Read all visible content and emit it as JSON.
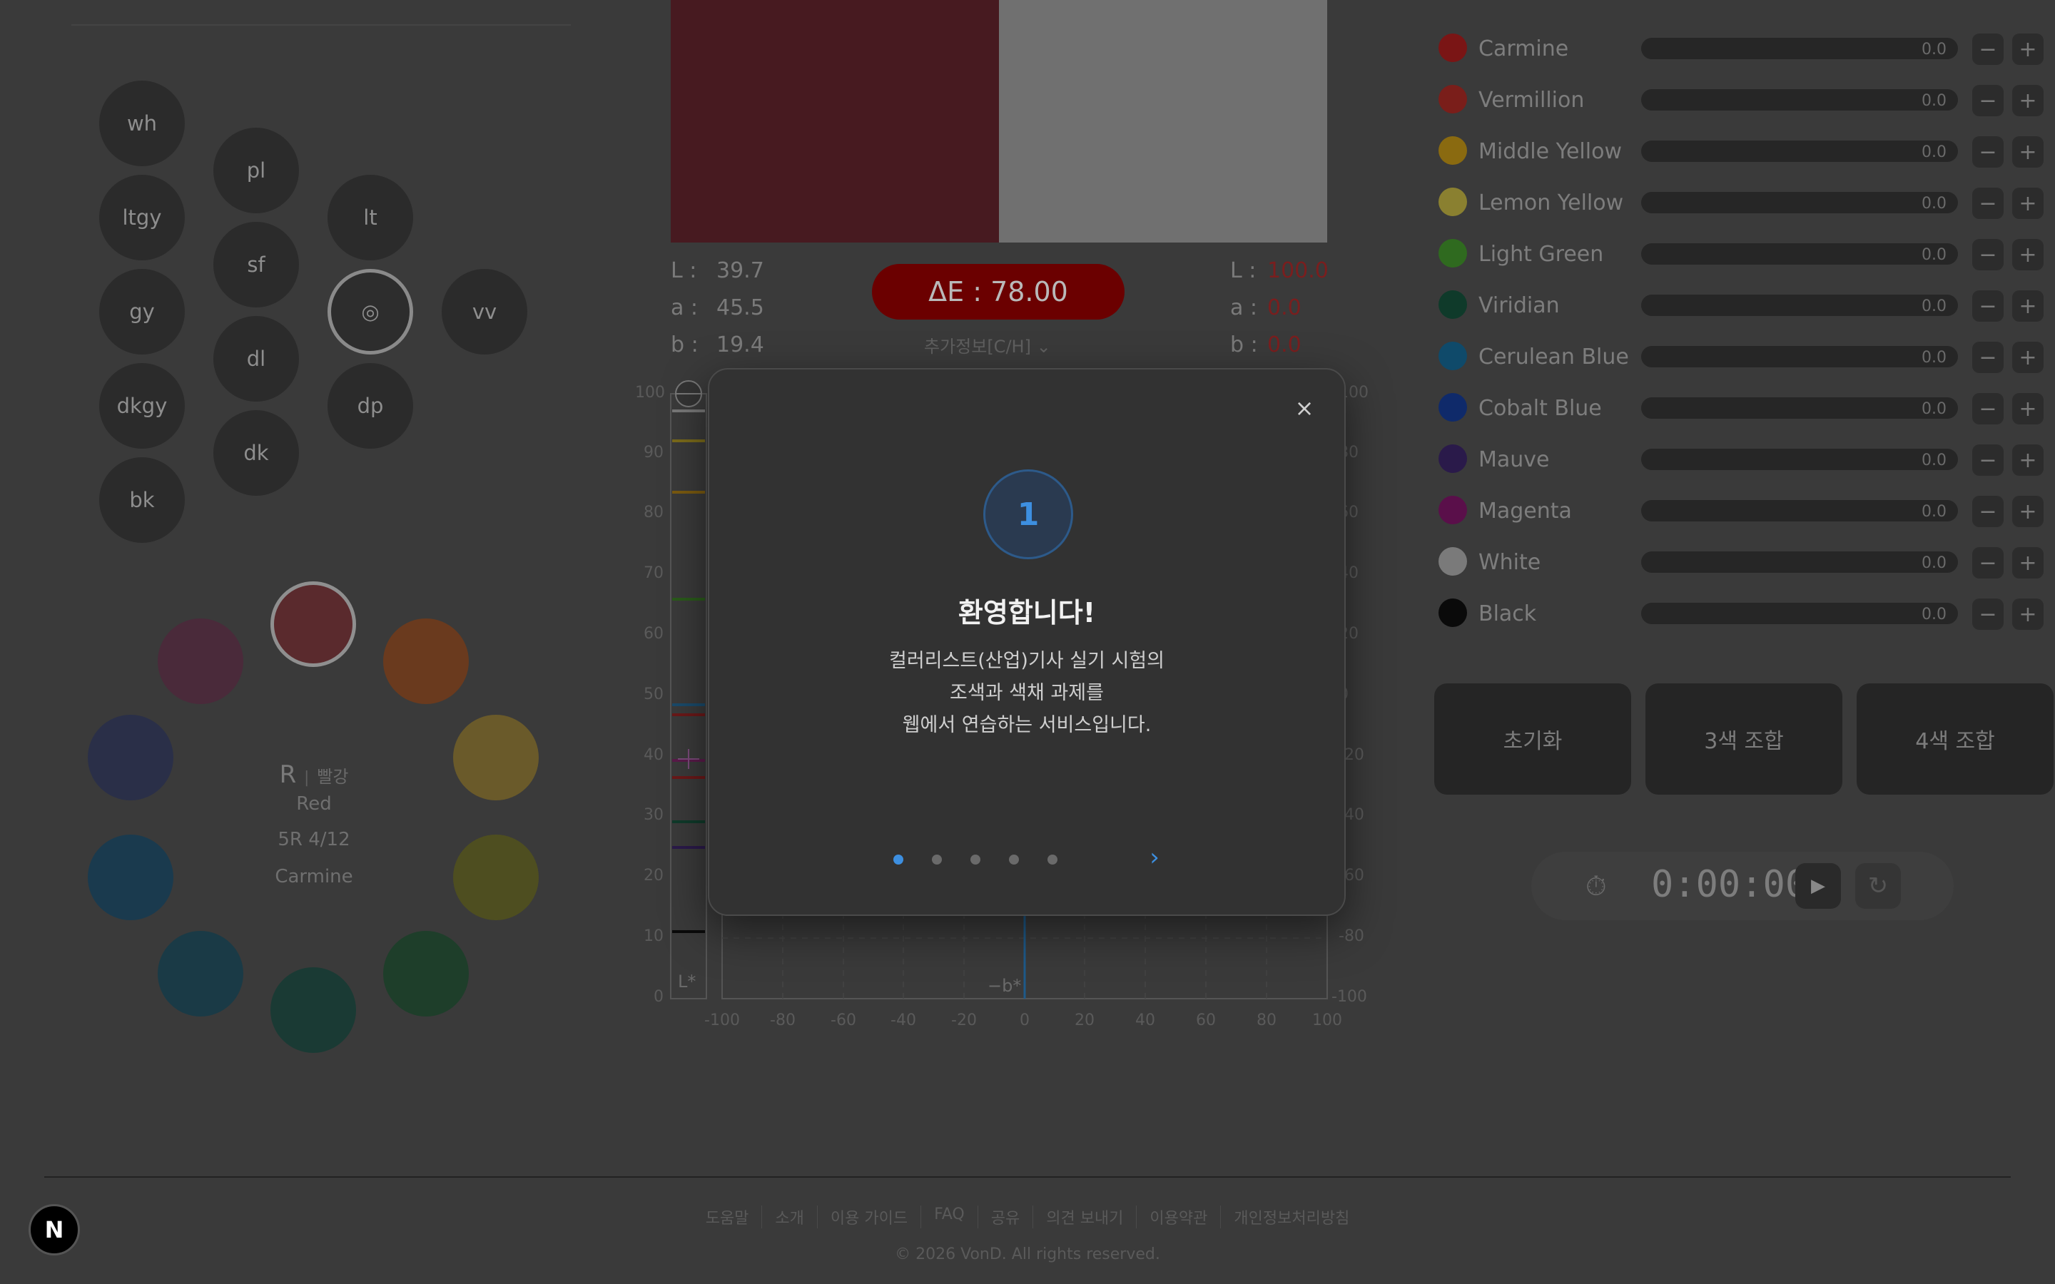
{
  "tones": [
    {
      "label": "wh"
    },
    {
      "label": "ltgy"
    },
    {
      "label": "gy"
    },
    {
      "label": "dkgy"
    },
    {
      "label": "bk"
    },
    {
      "label": "pl"
    },
    {
      "label": "sf"
    },
    {
      "label": "dl"
    },
    {
      "label": "dk"
    },
    {
      "label": "lt"
    },
    {
      "label": "◎"
    },
    {
      "label": "dp"
    },
    {
      "label": "vv"
    }
  ],
  "hue_wheel": {
    "colors": [
      "#5a2a2d",
      "#6a3a1e",
      "#6a5a2a",
      "#4e4e20",
      "#1e3e2a",
      "#1a3a34",
      "#1a3a46",
      "#1a3a4e",
      "#2a2f48",
      "#4a2a3a"
    ],
    "selected_info": {
      "code": "R",
      "separator": "|",
      "korean": "빨강",
      "english": "Red",
      "munsell": "5R 4/12",
      "pigment": "Carmine"
    }
  },
  "swatches": {
    "target_color": "#471a20",
    "mix_color": "#707070"
  },
  "lab_left": {
    "L_label": "L :",
    "L": "39.7",
    "a_label": "a :",
    "a": "45.5",
    "b_label": "b :",
    "b": "19.4"
  },
  "lab_right": {
    "L_label": "L :",
    "L": "100.0",
    "a_label": "a :",
    "a": "0.0",
    "b_label": "b :",
    "b": "0.0"
  },
  "delta_e": "ΔE : 78.00",
  "extra_info": "추가정보[C/H] ⌄",
  "chart": {
    "y_ticks": [
      "100",
      "90",
      "80",
      "70",
      "60",
      "50",
      "40",
      "30",
      "20",
      "10",
      "0"
    ],
    "y_ticks_right": [
      "100",
      "80",
      "60",
      "40",
      "20",
      "0",
      "-20",
      "-40",
      "-60",
      "-80",
      "-100"
    ],
    "x_ticks": [
      "-100",
      "-80",
      "-60",
      "-40",
      "-20",
      "0",
      "20",
      "40",
      "60",
      "80",
      "100"
    ],
    "l_axis_label": "L*",
    "b_axis_label": "−b*"
  },
  "pigments": [
    {
      "name": "Carmine",
      "color": "#7a1515",
      "value": "0.0"
    },
    {
      "name": "Vermillion",
      "color": "#7a1e1a",
      "value": "0.0"
    },
    {
      "name": "Middle Yellow",
      "color": "#8a6a10",
      "value": "0.0"
    },
    {
      "name": "Lemon Yellow",
      "color": "#8a8030",
      "value": "0.0"
    },
    {
      "name": "Light Green",
      "color": "#2f6a1f",
      "value": "0.0"
    },
    {
      "name": "Viridian",
      "color": "#0f3a2a",
      "value": "0.0"
    },
    {
      "name": "Cerulean Blue",
      "color": "#0f4a6a",
      "value": "0.0"
    },
    {
      "name": "Cobalt Blue",
      "color": "#0f2a6a",
      "value": "0.0"
    },
    {
      "name": "Mauve",
      "color": "#2a1a4a",
      "value": "0.0"
    },
    {
      "name": "Magenta",
      "color": "#5a0f4a",
      "value": "0.0"
    },
    {
      "name": "White",
      "color": "#7a7a7a",
      "value": "0.0"
    },
    {
      "name": "Black",
      "color": "#0a0a0a",
      "value": "0.0"
    }
  ],
  "pigment_minus": "−",
  "pigment_plus": "+",
  "actions": {
    "reset": "초기화",
    "three_color": "3색 조합",
    "four_color": "4색 조합"
  },
  "timer": {
    "time": "0:00:00",
    "play_icon": "▶",
    "reset_icon": "↻",
    "stopwatch_icon": "⏱"
  },
  "footer": {
    "links": [
      "도움말",
      "소개",
      "이용 가이드",
      "FAQ",
      "공유",
      "의견 보내기",
      "이용약관",
      "개인정보처리방침"
    ],
    "copyright": "© 2026 VonD. All rights reserved."
  },
  "badge": "N",
  "modal": {
    "close": "×",
    "step": "1",
    "title": "환영합니다!",
    "body_lines": [
      "컬러리스트(산업)기사 실기 시험의",
      "조색과 색채 과제를",
      "웹에서 연습하는 서비스입니다."
    ],
    "next": "›"
  }
}
